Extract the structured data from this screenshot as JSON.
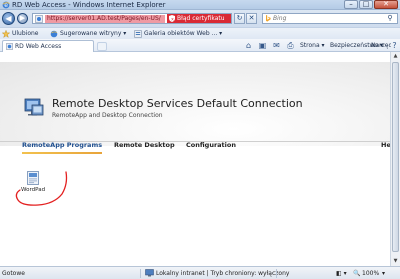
{
  "window": {
    "title": "RD Web Access - Windows Internet Explorer",
    "minimize": "–",
    "maximize": "□",
    "close": "✕"
  },
  "address": {
    "url": "https://server01.AD.test/Pages/en-US/",
    "cert_error": "Błąd certyfikatu",
    "refresh": "↻",
    "stop": "✕",
    "search_placeholder": "Bing",
    "search_button": "⚲"
  },
  "favorites": {
    "label": "Ulubione",
    "items": [
      "Sugerowane witryny ▾",
      "Galeria obiektów Web ... ▾"
    ]
  },
  "tab": {
    "label": "RD Web Access"
  },
  "commands": {
    "page": "Strona ▾",
    "security": "Bezpieczeństwo ▾",
    "tools": "Narzędzia ▾",
    "help": "?"
  },
  "rds": {
    "title": "Remote Desktop Services Default Connection",
    "subtitle": "RemoteApp and Desktop Connection",
    "nav": [
      "RemoteApp Programs",
      "Remote Desktop",
      "Configuration"
    ],
    "help": "He"
  },
  "apps": [
    {
      "label": "WordPad"
    }
  ],
  "status": {
    "left": "Gotowe",
    "zone": "Lokalny intranet | Tryb chroniony: wyłączony",
    "zoom": "100%"
  },
  "colors": {
    "active_tab": "#1f4f8f",
    "accent_bar": "#f2c14e",
    "cert_error_bg": "#d92a35",
    "annotation_red": "#e32020"
  }
}
